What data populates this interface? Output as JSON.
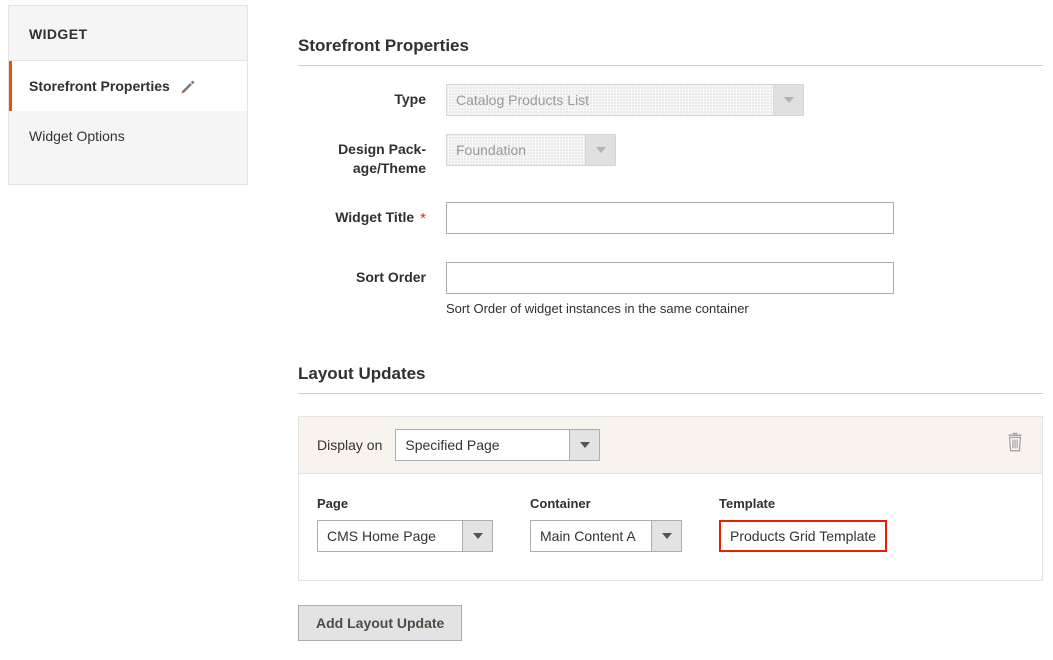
{
  "sidebar": {
    "header": "WIDGET",
    "items": [
      {
        "label": "Storefront Properties",
        "icon": "pencil-icon",
        "active": true
      },
      {
        "label": "Widget Options",
        "active": false
      }
    ]
  },
  "storefront": {
    "title": "Storefront Properties",
    "fields": {
      "type": {
        "label": "Type",
        "value": "Catalog Products List",
        "disabled": true
      },
      "design_package_theme": {
        "label": "Design Pack-\nage/Theme",
        "label_line1": "Design Pack-",
        "label_line2": "age/Theme",
        "value": "Foundation",
        "disabled": true
      },
      "widget_title": {
        "label": "Widget Title",
        "required_marker": "*",
        "value": "",
        "placeholder": ""
      },
      "sort_order": {
        "label": "Sort Order",
        "value": "",
        "placeholder": "",
        "note": "Sort Order of widget instances in the same container"
      }
    }
  },
  "layout_updates": {
    "title": "Layout Updates",
    "display_on": {
      "label": "Display on",
      "value": "Specified Page"
    },
    "delete_icon": "trash-icon",
    "columns": [
      {
        "label": "Page",
        "value": "CMS Home Page",
        "type": "select"
      },
      {
        "label": "Container",
        "value": "Main Content A",
        "type": "select"
      },
      {
        "label": "Template",
        "value": "Products Grid Template",
        "type": "highlighted"
      }
    ],
    "add_button": "Add Layout Update"
  },
  "colors": {
    "accent_orange": "#eb5202",
    "highlight_red": "#e81f00",
    "required_red": "#e02b27",
    "panel_head_bg": "#f8f3ec",
    "rule": "#d6cfbe"
  }
}
